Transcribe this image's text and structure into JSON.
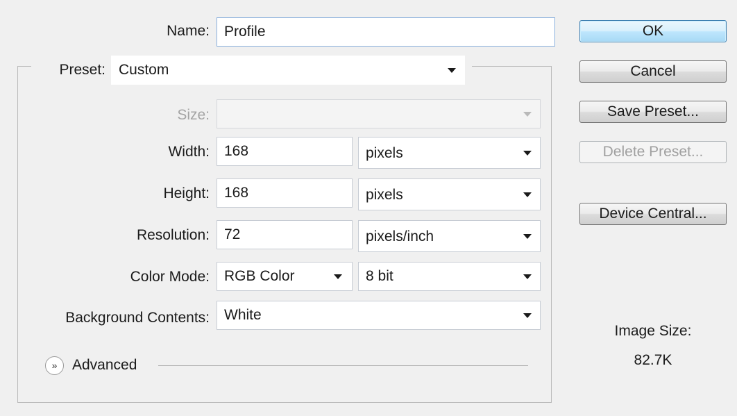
{
  "name": {
    "label": "Name:",
    "value": "Profile"
  },
  "preset": {
    "label": "Preset:",
    "value": "Custom"
  },
  "size": {
    "label": "Size:",
    "value": ""
  },
  "width": {
    "label": "Width:",
    "value": "168",
    "unit": "pixels"
  },
  "height": {
    "label": "Height:",
    "value": "168",
    "unit": "pixels"
  },
  "resolution": {
    "label": "Resolution:",
    "value": "72",
    "unit": "pixels/inch"
  },
  "color_mode": {
    "label": "Color Mode:",
    "mode": "RGB Color",
    "depth": "8 bit"
  },
  "background": {
    "label": "Background Contents:",
    "value": "White"
  },
  "advanced": {
    "label": "Advanced"
  },
  "buttons": {
    "ok": "OK",
    "cancel": "Cancel",
    "save_preset": "Save Preset...",
    "delete_preset": "Delete Preset...",
    "device_central": "Device Central..."
  },
  "image_size": {
    "label": "Image Size:",
    "value": "82.7K"
  },
  "icons": {
    "dropdown": "chevron-down-icon",
    "advanced_toggle": "double-chevron-down-icon"
  }
}
